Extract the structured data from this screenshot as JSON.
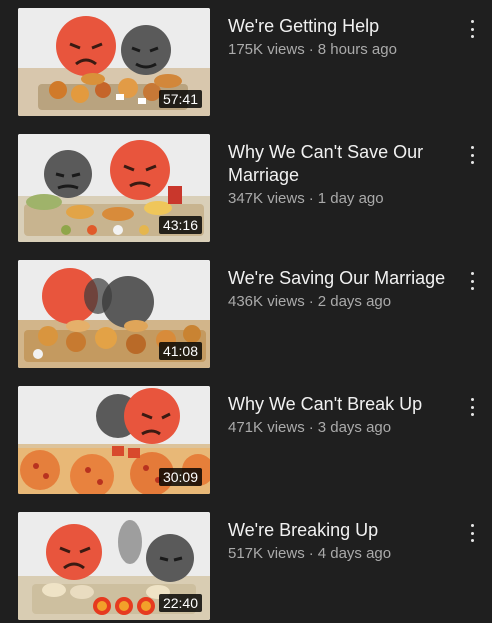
{
  "videos": [
    {
      "title": "We're Getting Help",
      "views": "175K views",
      "age": "8 hours ago",
      "duration": "57:41",
      "thumb_icon": "red-and-dark-emoji-over-fast-food-thumbnail"
    },
    {
      "title": "Why We Can't Save Our Marriage",
      "views": "347K views",
      "age": "1 day ago",
      "duration": "43:16",
      "thumb_icon": "dark-and-red-emoji-over-feast-thumbnail"
    },
    {
      "title": "We're Saving Our Marriage",
      "views": "436K views",
      "age": "2 days ago",
      "duration": "41:08",
      "thumb_icon": "red-and-dark-emoji-over-chicken-thumbnail"
    },
    {
      "title": "Why We Can't Break Up",
      "views": "471K views",
      "age": "3 days ago",
      "duration": "30:09",
      "thumb_icon": "dark-and-red-emoji-over-pizza-thumbnail"
    },
    {
      "title": "We're Breaking Up",
      "views": "517K views",
      "age": "4 days ago",
      "duration": "22:40",
      "thumb_icon": "red-and-dark-emoji-over-dumplings-thumbnail"
    }
  ],
  "separator": "·",
  "colors": {
    "background": "#1f1f1f",
    "title": "#f1f1f1",
    "meta": "#aaaaaa",
    "red_emoji": "#e8553d",
    "dark_emoji": "#5a5a5a"
  },
  "icons": [
    "more-vert-icon"
  ]
}
